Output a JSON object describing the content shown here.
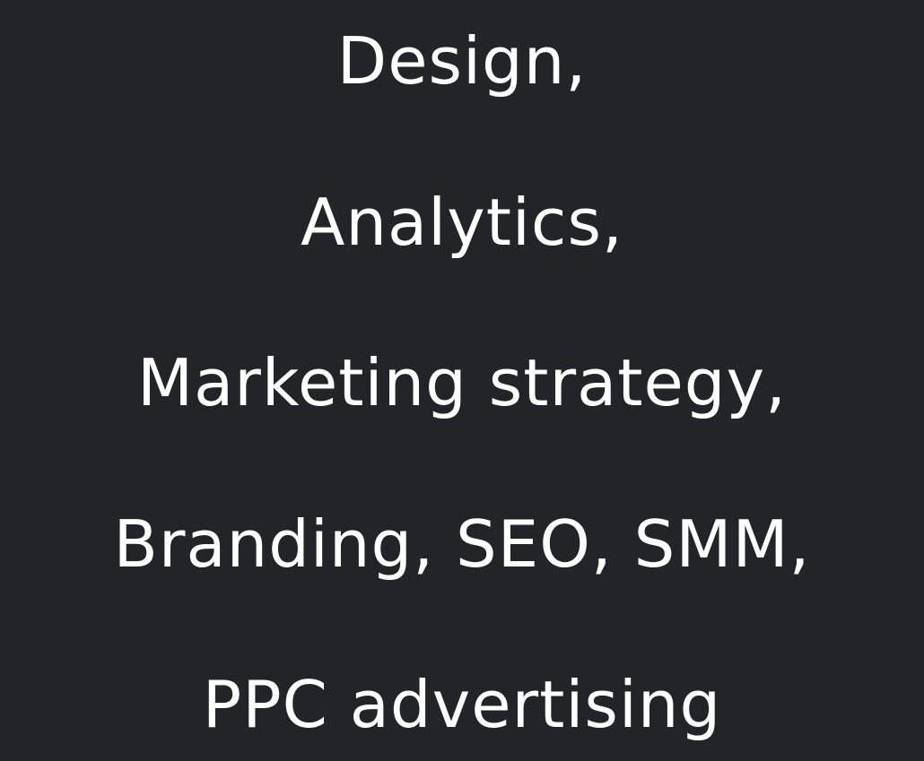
{
  "services": {
    "lines": [
      "Design,",
      "Analytics,",
      "Marketing strategy,",
      "Branding, SEO, SMM,",
      "PPC advertising"
    ]
  },
  "colors": {
    "background": "#232428",
    "text": "#ffffff"
  }
}
